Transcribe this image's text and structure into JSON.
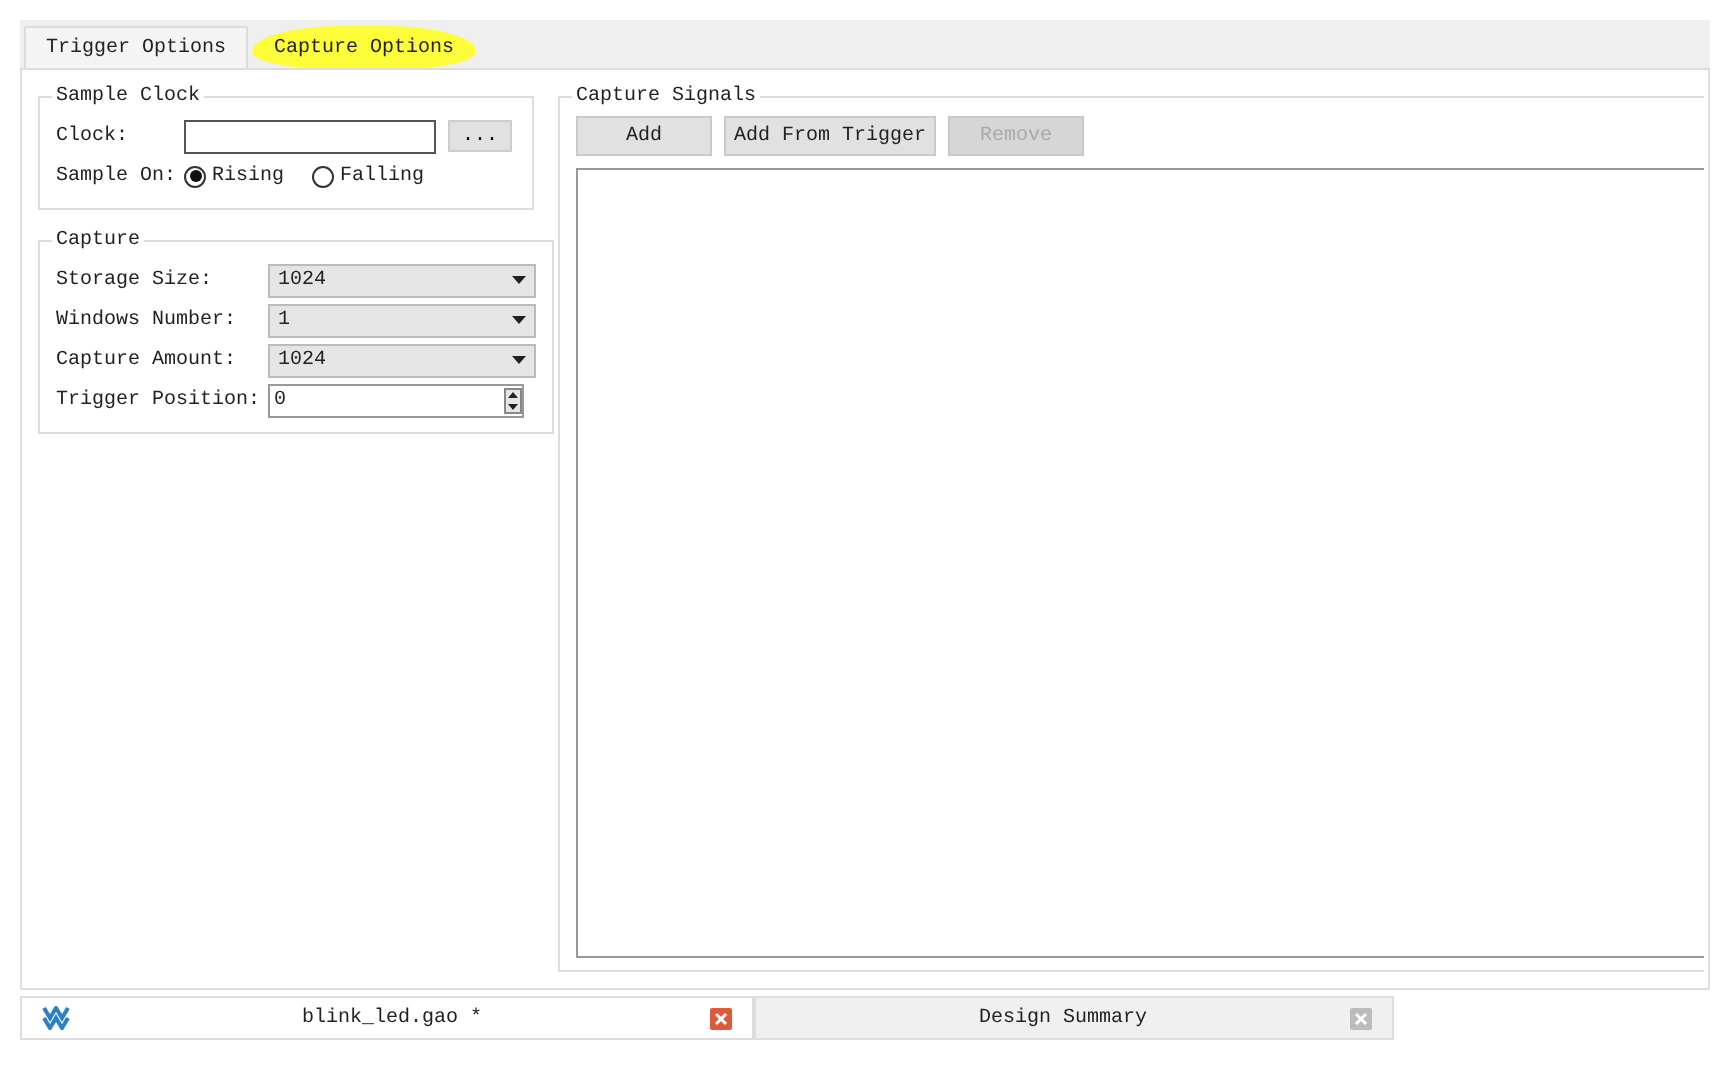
{
  "tabs": [
    {
      "label": "Trigger Options",
      "selected": false
    },
    {
      "label": "Capture Options",
      "selected": true
    }
  ],
  "sample_clock": {
    "title": "Sample Clock",
    "clock_label": "Clock:",
    "browse_button": "...",
    "sample_on_label": "Sample On:",
    "options": [
      {
        "label": "Rising",
        "selected": true
      },
      {
        "label": "Falling",
        "selected": false
      }
    ]
  },
  "capture": {
    "title": "Capture",
    "fields": [
      {
        "kind": "dropdown",
        "label": "Storage Size:",
        "value": "1024"
      },
      {
        "kind": "dropdown",
        "label": "Windows Number:",
        "value": "1"
      },
      {
        "kind": "dropdown",
        "label": "Capture Amount:",
        "value": "1024"
      },
      {
        "kind": "spinner",
        "label": "Trigger Position:",
        "value": "0"
      }
    ]
  },
  "capture_signals": {
    "title": "Capture Signals",
    "buttons": [
      {
        "label": "Add",
        "disabled": false
      },
      {
        "label": "Add From Trigger",
        "disabled": false
      },
      {
        "label": "Remove",
        "disabled": true
      }
    ]
  },
  "document_tabs": [
    {
      "label": "blink_led.gao *",
      "selected": true
    },
    {
      "label": "Design Summary",
      "selected": false
    }
  ]
}
